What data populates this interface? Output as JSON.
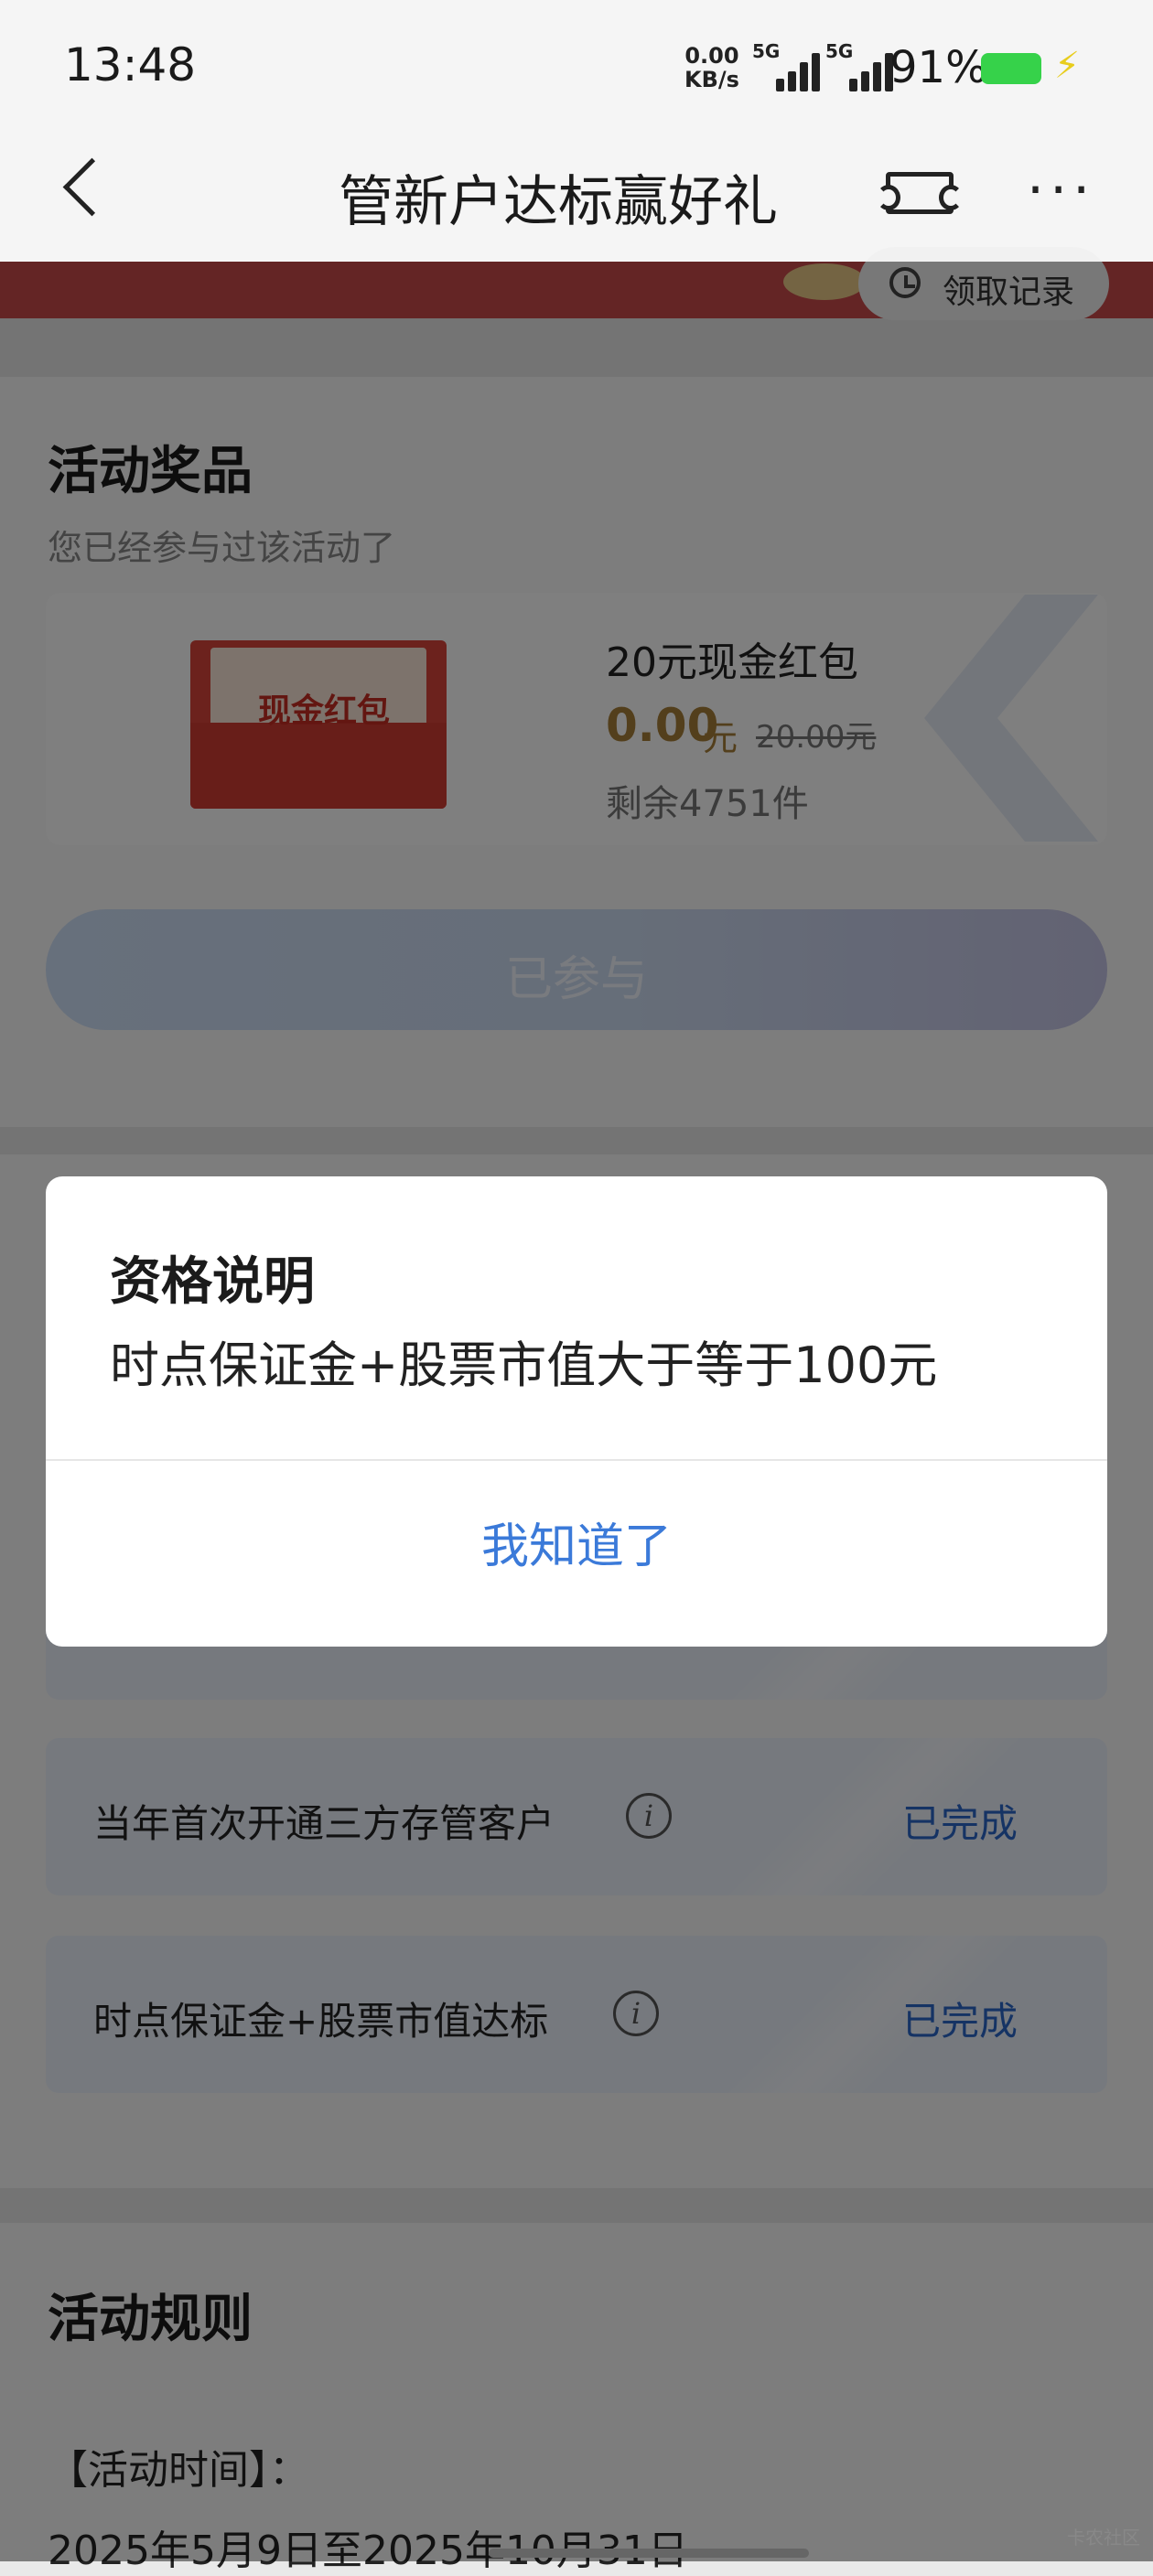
{
  "status_bar": {
    "time": "13:48",
    "net_speed_value": "0.00",
    "net_speed_unit": "KB/s",
    "sim1": "5G",
    "sim2": "5G",
    "battery": "91%",
    "battery_color": "#36d24a"
  },
  "nav": {
    "title": "管新户达标赢好礼",
    "back_icon": "chevron-left-icon",
    "ticket_icon": "ticket-icon",
    "more_icon": "more-icon"
  },
  "records_label": "领取记录",
  "prizes": {
    "title": "活动奖品",
    "subtitle": "您已经参与过该活动了",
    "item": {
      "image_label": "现金红包",
      "name": "20元现金红包",
      "price": "0.00",
      "price_unit": "元",
      "original_price": "20.00元",
      "remaining": "剩余4751件"
    },
    "button_label": "已参与"
  },
  "tasks": [
    {
      "label": "",
      "status": ""
    },
    {
      "label": "当年首次开通三方存管客户",
      "status": "已完成"
    },
    {
      "label": "时点保证金+股票市值达标",
      "status": "已完成"
    }
  ],
  "rules": {
    "title": "活动规则",
    "time_label": "【活动时间】：",
    "time_value": "2025年5月9日至2025年10月31日"
  },
  "dialog": {
    "title": "资格说明",
    "body": "时点保证金+股票市值大于等于100元",
    "confirm_label": "我知道了"
  },
  "watermark": "卡农社区",
  "colors": {
    "accent_blue": "#3b7ad9",
    "price_gold": "#a77e39",
    "banner_red": "#c84b4a"
  }
}
